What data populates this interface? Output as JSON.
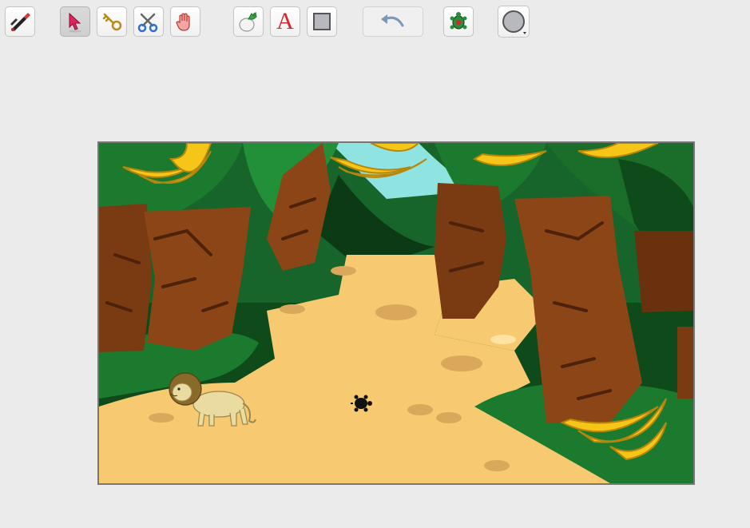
{
  "toolbar": {
    "tools": [
      {
        "name": "paint-editor-tool",
        "icon": "paintbrush-icon"
      },
      {
        "name": "select-arrow-tool",
        "icon": "arrow-pointer-icon",
        "selected": true
      },
      {
        "name": "grow-tool",
        "icon": "key-icon"
      },
      {
        "name": "cut-tool",
        "icon": "scissors-icon"
      },
      {
        "name": "shrink-tool",
        "icon": "hand-icon"
      },
      {
        "name": "new-sprite-tool",
        "icon": "sprite-egg-icon"
      },
      {
        "name": "text-tool",
        "icon": "letter-a-icon",
        "glyph": "A"
      },
      {
        "name": "rectangle-tool",
        "icon": "square-icon"
      },
      {
        "name": "undo-button",
        "icon": "undo-arrow-icon"
      },
      {
        "name": "turtle-tool",
        "icon": "turtle-icon"
      },
      {
        "name": "pen-color-tool",
        "icon": "circle-dropdown-icon"
      }
    ]
  },
  "stage": {
    "scene": "jungle-background",
    "sprites": [
      "lion-sprite",
      "turtle-sprite"
    ]
  },
  "colors": {
    "background": "#ebebeb",
    "path": "#f7c970",
    "jungle_dark": "#0f4a1b",
    "jungle_mid": "#1c7a2e",
    "trunk": "#7a3b13",
    "banana": "#f5c518",
    "sky": "#8fe3e0"
  }
}
